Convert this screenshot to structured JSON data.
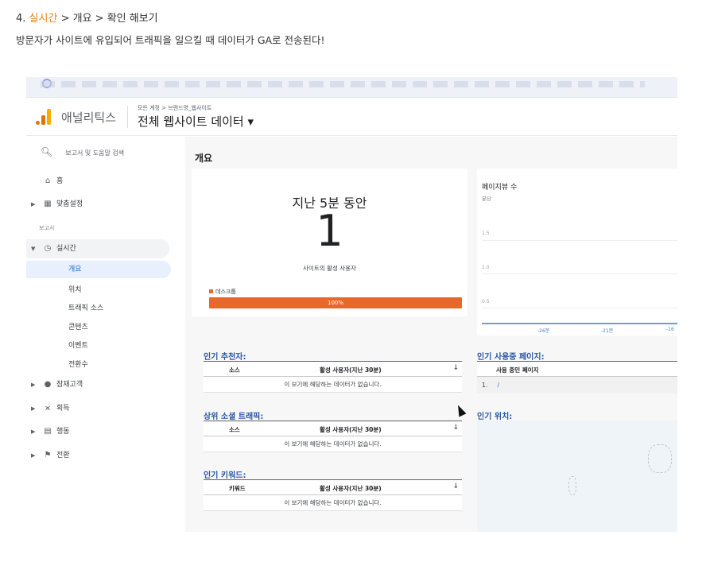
{
  "post": {
    "num": "4.",
    "realtime": "실시간",
    "sep1": " > 개요 > ",
    "rest": "확인 해보기",
    "subtitle": "방문자가 사이트에 유입되어 트래픽을 일으킬 때 데이터가 GA로 전송된다!"
  },
  "ga": {
    "app_name": "애널리틱스",
    "breadcrumb": "모든 계정 > 브랜드명_웹사이트",
    "property": "전체 웹사이트 데이터 ▾",
    "search_placeholder": "보고서 및 도움말 검색",
    "nav": {
      "home": "홈",
      "custom": "맞춤설정",
      "reports_section": "보고서",
      "realtime": "실시간",
      "realtime_sub": [
        "개요",
        "위치",
        "트래픽 소스",
        "콘텐츠",
        "이벤트",
        "전환수"
      ],
      "audience": "잠재고객",
      "acquisition": "획득",
      "behavior": "행동",
      "conversions": "전환"
    },
    "main": {
      "title": "개요",
      "rt_title": "지난 5분 동안",
      "active_users": "1",
      "active_label": "사이트의 활성 사용자",
      "device_label": "데스크톱",
      "device_percent": "100%",
      "device_share": 1.0,
      "pv_title": "페이지뷰 수",
      "pv_unit": "분당",
      "pv_ticks": [
        "1.5",
        "1.0",
        "0.5"
      ],
      "pv_xticks": [
        "-26분",
        "-21분",
        "-16"
      ],
      "referrers_title": "인기 추천자:",
      "social_title": "상위 소셜 트래픽:",
      "keywords_title": "인기 키워드:",
      "col_source": "소스",
      "col_keyword": "키워드",
      "col_active": "활성 사용자(지난 30분)",
      "no_data": "이 보기에 해당하는 데이터가 없습니다.",
      "pages_title": "인기 사용중 페이지:",
      "col_page": "사용 중인 페이지",
      "page_row_num": "1.",
      "page_row_path": "/",
      "locations_title": "인기 위치:"
    }
  }
}
